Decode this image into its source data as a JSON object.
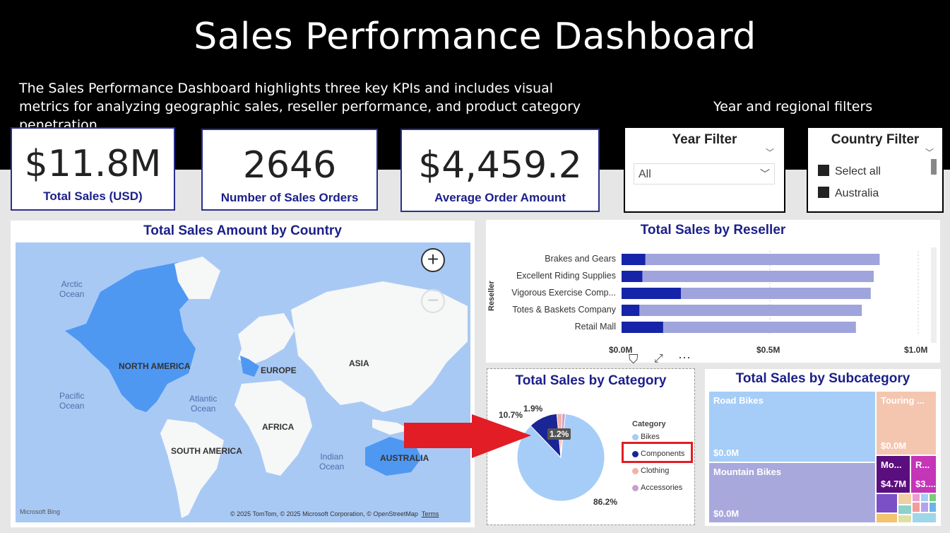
{
  "header": {
    "title": "Sales Performance Dashboard",
    "description": "The Sales Performance Dashboard highlights three key KPIs and includes visual metrics for analyzing geographic sales, reseller performance, and product category penetration.",
    "filters_note": "Year and regional filters"
  },
  "kpis": [
    {
      "value": "$11.8M",
      "label": "Total Sales (USD)"
    },
    {
      "value": "2646",
      "label": "Number of Sales Orders"
    },
    {
      "value": "$4,459.2",
      "label": "Average Order Amount"
    }
  ],
  "year_filter": {
    "title": "Year Filter",
    "selected": "All"
  },
  "country_filter": {
    "title": "Country Filter",
    "options": [
      "Select all",
      "Australia"
    ]
  },
  "map": {
    "title": "Total Sales Amount by Country",
    "continents": [
      "NORTH AMERICA",
      "EUROPE",
      "ASIA",
      "AFRICA",
      "SOUTH AMERICA",
      "AUSTRALIA"
    ],
    "oceans": [
      "Arctic\nOcean",
      "Pacific\nOcean",
      "Atlantic\nOcean",
      "Indian\nOcean"
    ],
    "zoom_in": "+",
    "zoom_out": "−",
    "attribution": "© 2025 TomTom, © 2025 Microsoft Corporation, © OpenStreetMap",
    "terms": "Terms",
    "brand": "Microsoft Bing"
  },
  "reseller_chart": {
    "title": "Total Sales by Reseller",
    "ylabel": "Reseller",
    "xticks": [
      "$0.0M",
      "$0.5M",
      "$1.0M"
    ],
    "colors": {
      "dark": "#1524a8",
      "light": "#9fa4dc"
    }
  },
  "category_chart": {
    "title": "Total Sales by Category",
    "legend_title": "Category",
    "labels": [
      "10.7%",
      "1.9%",
      "1.2%",
      "86.2%"
    ]
  },
  "subcategory_chart": {
    "title": "Total Sales by Subcategory",
    "tiles": [
      {
        "name": "Road Bikes",
        "value": "$0.0M"
      },
      {
        "name": "Touring ...",
        "value": "$0.0M"
      },
      {
        "name": "Mountain Bikes",
        "value": "$0.0M"
      },
      {
        "name": "Mo...",
        "value": "$4.7M"
      },
      {
        "name": "R...",
        "value": "$3...."
      }
    ]
  },
  "chart_data": [
    {
      "type": "bar",
      "title": "Total Sales by Reseller",
      "ylabel": "Reseller",
      "xlim": [
        0,
        1.0
      ],
      "categories": [
        "Brakes and Gears",
        "Excellent Riding Supplies",
        "Vigorous Exercise Comp...",
        "Totes & Baskets Company",
        "Retail Mall"
      ],
      "series": [
        {
          "values": [
            0.08,
            0.07,
            0.2,
            0.06,
            0.14
          ]
        },
        {
          "values": [
            0.87,
            0.85,
            0.84,
            0.81,
            0.79
          ]
        }
      ]
    },
    {
      "type": "pie",
      "title": "Total Sales by Category",
      "categories": [
        "Bikes",
        "Components",
        "Clothing",
        "Accessories"
      ],
      "values": [
        86.2,
        10.7,
        1.9,
        1.2
      ],
      "colors": [
        "#a5cdf7",
        "#1a2596",
        "#f4b0a6",
        "#c79fd0"
      ]
    }
  ]
}
